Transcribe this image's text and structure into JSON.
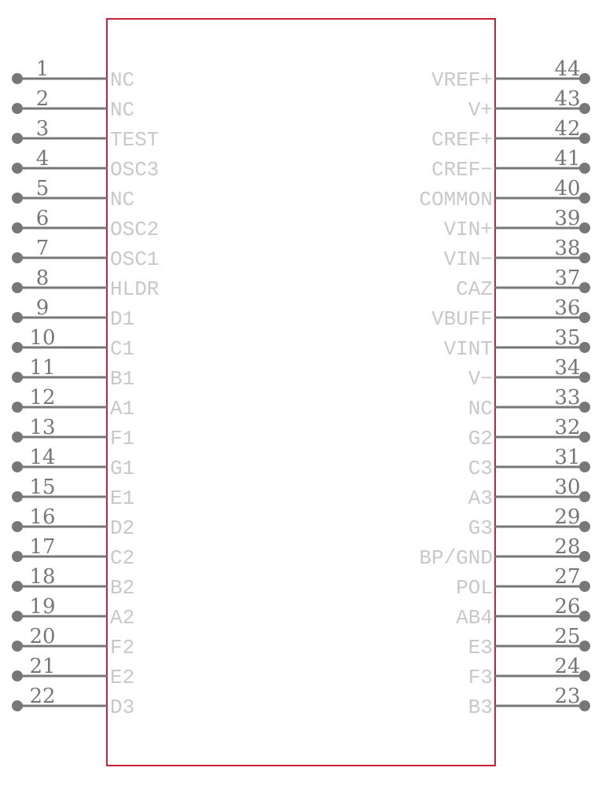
{
  "component": {
    "type": "schematic-symbol",
    "body_color": "#c8203a",
    "pin_color": "#777777",
    "label_color": "#c8c8c8"
  },
  "left_pins": [
    {
      "number": "1",
      "name": "NC"
    },
    {
      "number": "2",
      "name": "NC"
    },
    {
      "number": "3",
      "name": "TEST"
    },
    {
      "number": "4",
      "name": "OSC3"
    },
    {
      "number": "5",
      "name": "NC"
    },
    {
      "number": "6",
      "name": "OSC2"
    },
    {
      "number": "7",
      "name": "OSC1"
    },
    {
      "number": "8",
      "name": "HLDR"
    },
    {
      "number": "9",
      "name": "D1"
    },
    {
      "number": "10",
      "name": "C1"
    },
    {
      "number": "11",
      "name": "B1"
    },
    {
      "number": "12",
      "name": "A1"
    },
    {
      "number": "13",
      "name": "F1"
    },
    {
      "number": "14",
      "name": "G1"
    },
    {
      "number": "15",
      "name": "E1"
    },
    {
      "number": "16",
      "name": "D2"
    },
    {
      "number": "17",
      "name": "C2"
    },
    {
      "number": "18",
      "name": "B2"
    },
    {
      "number": "19",
      "name": "A2"
    },
    {
      "number": "20",
      "name": "F2"
    },
    {
      "number": "21",
      "name": "E2"
    },
    {
      "number": "22",
      "name": "D3"
    }
  ],
  "right_pins": [
    {
      "number": "44",
      "name": "VREF+"
    },
    {
      "number": "43",
      "name": "V+"
    },
    {
      "number": "42",
      "name": "CREF+"
    },
    {
      "number": "41",
      "name": "CREF−"
    },
    {
      "number": "40",
      "name": "COMMON"
    },
    {
      "number": "39",
      "name": "VIN+"
    },
    {
      "number": "38",
      "name": "VIN−"
    },
    {
      "number": "37",
      "name": "CAZ"
    },
    {
      "number": "36",
      "name": "VBUFF"
    },
    {
      "number": "35",
      "name": "VINT"
    },
    {
      "number": "34",
      "name": "V−"
    },
    {
      "number": "33",
      "name": "NC"
    },
    {
      "number": "32",
      "name": "G2"
    },
    {
      "number": "31",
      "name": "C3"
    },
    {
      "number": "30",
      "name": "A3"
    },
    {
      "number": "29",
      "name": "G3"
    },
    {
      "number": "28",
      "name": "BP/GND"
    },
    {
      "number": "27",
      "name": "POL"
    },
    {
      "number": "26",
      "name": "AB4"
    },
    {
      "number": "25",
      "name": "E3"
    },
    {
      "number": "24",
      "name": "F3"
    },
    {
      "number": "23",
      "name": "B3"
    }
  ]
}
